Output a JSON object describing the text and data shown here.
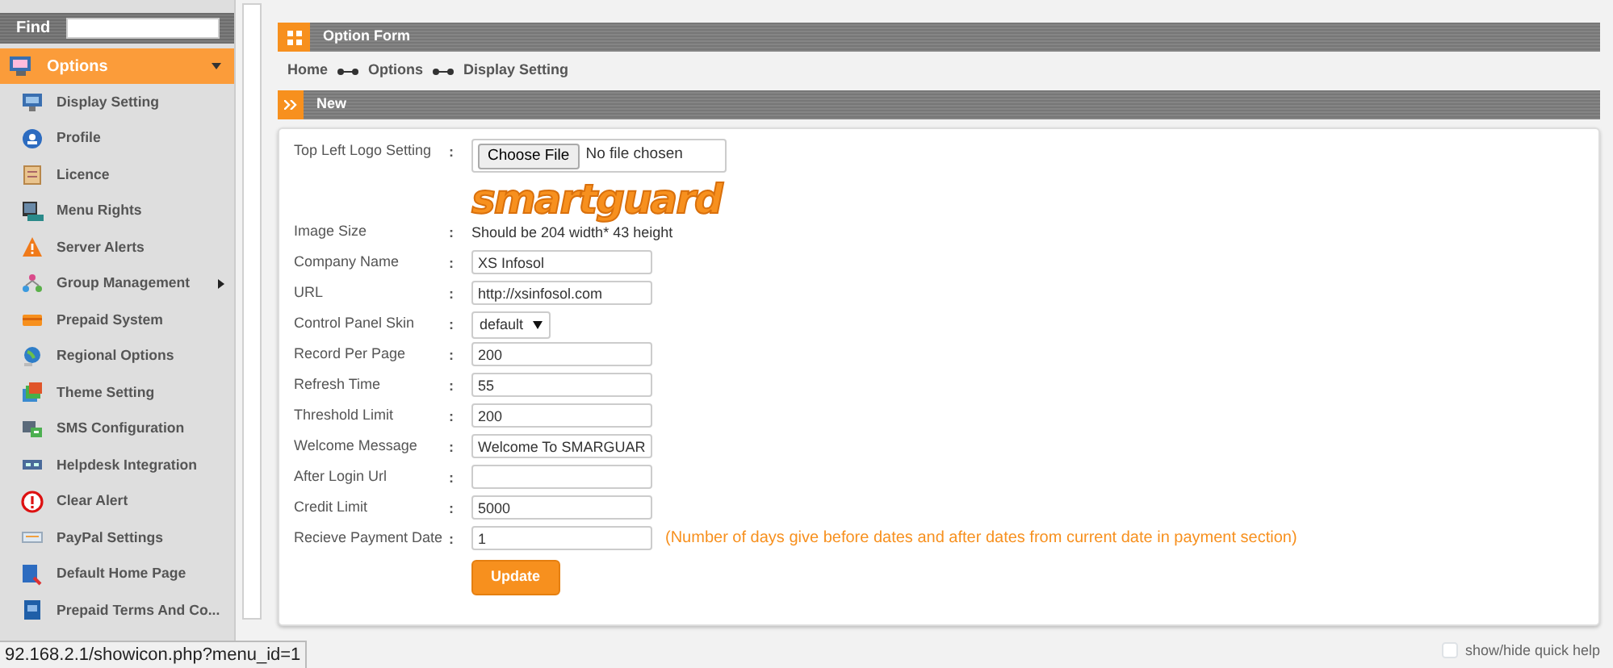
{
  "sidebar": {
    "find_label": "Find",
    "section": {
      "label": "Options",
      "expanded": true
    },
    "items": [
      {
        "label": "Display Setting",
        "submenu": false
      },
      {
        "label": "Profile",
        "submenu": false
      },
      {
        "label": "Licence",
        "submenu": false
      },
      {
        "label": "Menu Rights",
        "submenu": false
      },
      {
        "label": "Server Alerts",
        "submenu": false
      },
      {
        "label": "Group Management",
        "submenu": true
      },
      {
        "label": "Prepaid System",
        "submenu": false
      },
      {
        "label": "Regional Options",
        "submenu": false
      },
      {
        "label": "Theme Setting",
        "submenu": false
      },
      {
        "label": "SMS Configuration",
        "submenu": false
      },
      {
        "label": "Helpdesk Integration",
        "submenu": false
      },
      {
        "label": "Clear Alert",
        "submenu": false
      },
      {
        "label": "PayPal Settings",
        "submenu": false
      },
      {
        "label": "Default Home Page",
        "submenu": false
      },
      {
        "label": "Prepaid Terms And Co...",
        "submenu": false
      }
    ]
  },
  "panel_title": "Option Form",
  "breadcrumb": [
    "Home",
    "Options",
    "Display Setting"
  ],
  "section_title": "New",
  "form": [
    {
      "kind": "file",
      "label": "Top Left Logo Setting",
      "separator": ":",
      "button": "Choose File",
      "value": "No file chosen"
    },
    {
      "kind": "logo",
      "text": "smartguard"
    },
    {
      "kind": "note",
      "label": "Image Size",
      "separator": ":",
      "value": "Should be 204 width* 43 height"
    },
    {
      "kind": "text",
      "label": "Company Name",
      "separator": ":",
      "value": "XS Infosol"
    },
    {
      "kind": "text",
      "label": "URL",
      "separator": ":",
      "value": "http://xsinfosol.com"
    },
    {
      "kind": "select",
      "label": "Control Panel Skin",
      "separator": ":",
      "value": "default"
    },
    {
      "kind": "text",
      "label": "Record Per Page",
      "separator": ":",
      "value": "200"
    },
    {
      "kind": "text",
      "label": "Refresh Time",
      "separator": ":",
      "value": "55"
    },
    {
      "kind": "text",
      "label": "Threshold Limit",
      "separator": ":",
      "value": "200"
    },
    {
      "kind": "text",
      "label": "Welcome Message",
      "separator": ":",
      "value": "Welcome To SMARGUAR"
    },
    {
      "kind": "text",
      "label": "After Login Url",
      "separator": ":"
    },
    {
      "kind": "text",
      "label": "Credit Limit",
      "separator": ":",
      "value": "5000"
    },
    {
      "kind": "text",
      "label": "Recieve Payment Date",
      "separator": ":",
      "value": "1",
      "hint": "(Number of days give before dates and after dates from current date in payment section)"
    }
  ],
  "submit": "Update",
  "quick_help": {
    "label": "show/hide quick help",
    "checked": false
  },
  "status_url": "92.168.2.1/showicon.php?menu_id=1"
}
